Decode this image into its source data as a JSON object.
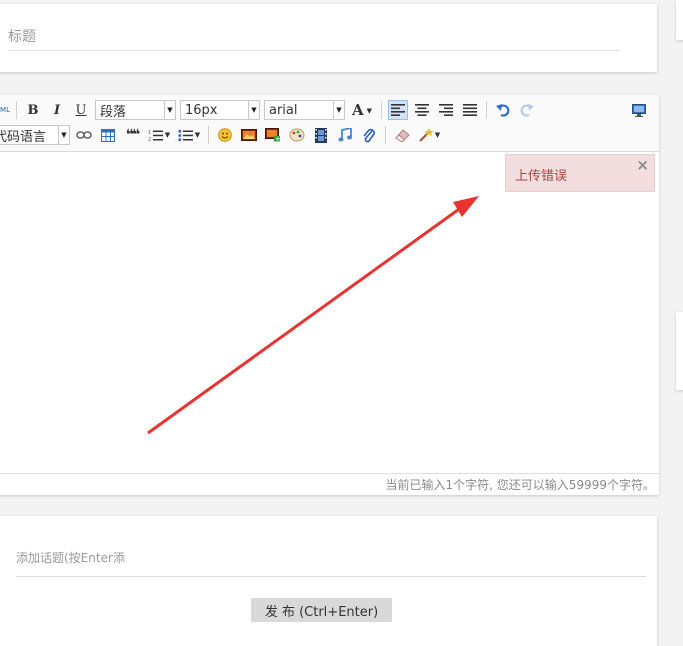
{
  "title_field": {
    "placeholder": "标题"
  },
  "toolbar": {
    "source_label": "HTML",
    "bold_label": "B",
    "italic_label": "I",
    "underline_label": "U",
    "paragraph_select": "段落",
    "fontsize_select": "16px",
    "fontfamily_select": "arial",
    "fontcolor_label": "A",
    "code_language_select": "代码语言",
    "quote_label": "❝❝"
  },
  "error_popup": {
    "message": "上传错误",
    "close_glyph": "×"
  },
  "status_bar": {
    "text": "当前已输入1个字符, 您还可以输入59999个字符。"
  },
  "topic_field": {
    "placeholder": "添加话题(按Enter添"
  },
  "publish_button": {
    "label": "发 布 (Ctrl+Enter)"
  },
  "colors": {
    "error_bg": "#f2dede",
    "error_text": "#a94442",
    "arrow": "#e8332e",
    "active_btn": "#d4e2f7"
  }
}
